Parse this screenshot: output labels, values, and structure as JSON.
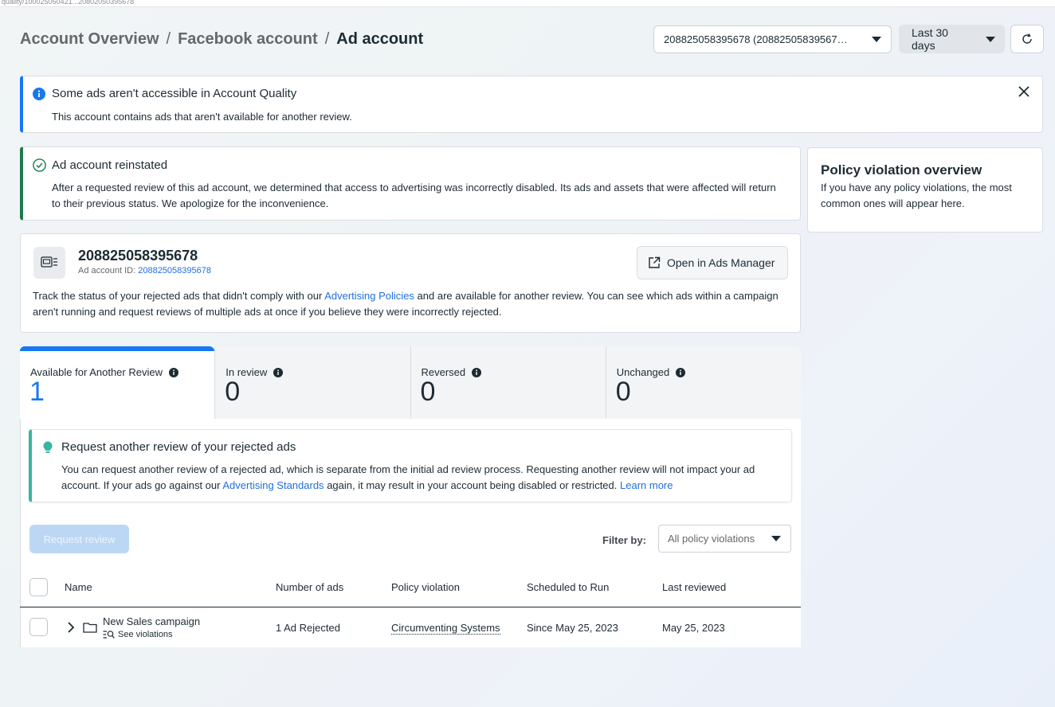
{
  "topstrip": {
    "text": "quality/100025050421...20802050395678"
  },
  "breadcrumb": {
    "items": [
      "Account Overview",
      "Facebook account"
    ],
    "current": "Ad account",
    "separator": "/"
  },
  "header": {
    "account_select": "208825058395678 (20882505839567…",
    "date_select": "Last 30 days"
  },
  "info_banner": {
    "title": "Some ads aren't accessible in Account Quality",
    "body": "This account contains ads that aren't available for another review."
  },
  "reinstated_banner": {
    "title": "Ad account reinstated",
    "body": "After a requested review of this ad account, we determined that access to advertising was incorrectly disabled. Its ads and assets that were affected will return to their previous status. We apologize for the inconvenience."
  },
  "policy_overview": {
    "title": "Policy violation overview",
    "body": "If you have any policy violations, the most common ones will appear here."
  },
  "account_card": {
    "name": "208825058395678",
    "id_label": "Ad account ID:",
    "id_value": "208825058395678",
    "open_button": "Open in Ads Manager",
    "desc_pre": "Track the status of your rejected ads that didn't comply with our",
    "desc_link": "Advertising Policies",
    "desc_post": "and are available for another review. You can see which ads within a campaign aren't running and request reviews of multiple ads at once if you believe they were incorrectly rejected."
  },
  "tabs": [
    {
      "label": "Available for Another Review",
      "count": "1"
    },
    {
      "label": "In review",
      "count": "0"
    },
    {
      "label": "Reversed",
      "count": "0"
    },
    {
      "label": "Unchanged",
      "count": "0"
    }
  ],
  "tip": {
    "title": "Request another review of your rejected ads",
    "body_pre": "You can request another review of a rejected ad, which is separate from the initial ad review process. Requesting another review will not impact your ad account. If your ads go against our",
    "link1": "Advertising Standards",
    "body_mid": "again, it may result in your account being disabled or restricted.",
    "link2": "Learn more"
  },
  "actions": {
    "request_review": "Request review",
    "filter_label": "Filter by:",
    "filter_value": "All policy violations"
  },
  "table": {
    "headers": [
      "Name",
      "Number of ads",
      "Policy violation",
      "Scheduled to Run",
      "Last reviewed"
    ],
    "rows": [
      {
        "name": "New Sales campaign",
        "sub": "See violations",
        "ads": "1 Ad Rejected",
        "violation": "Circumventing Systems",
        "scheduled": "Since May 25, 2023",
        "reviewed": "May 25, 2023"
      }
    ]
  },
  "colors": {
    "accent": "#1877f2",
    "success": "#1e7a4c",
    "tip": "#39b59f",
    "link": "#216fdb"
  }
}
